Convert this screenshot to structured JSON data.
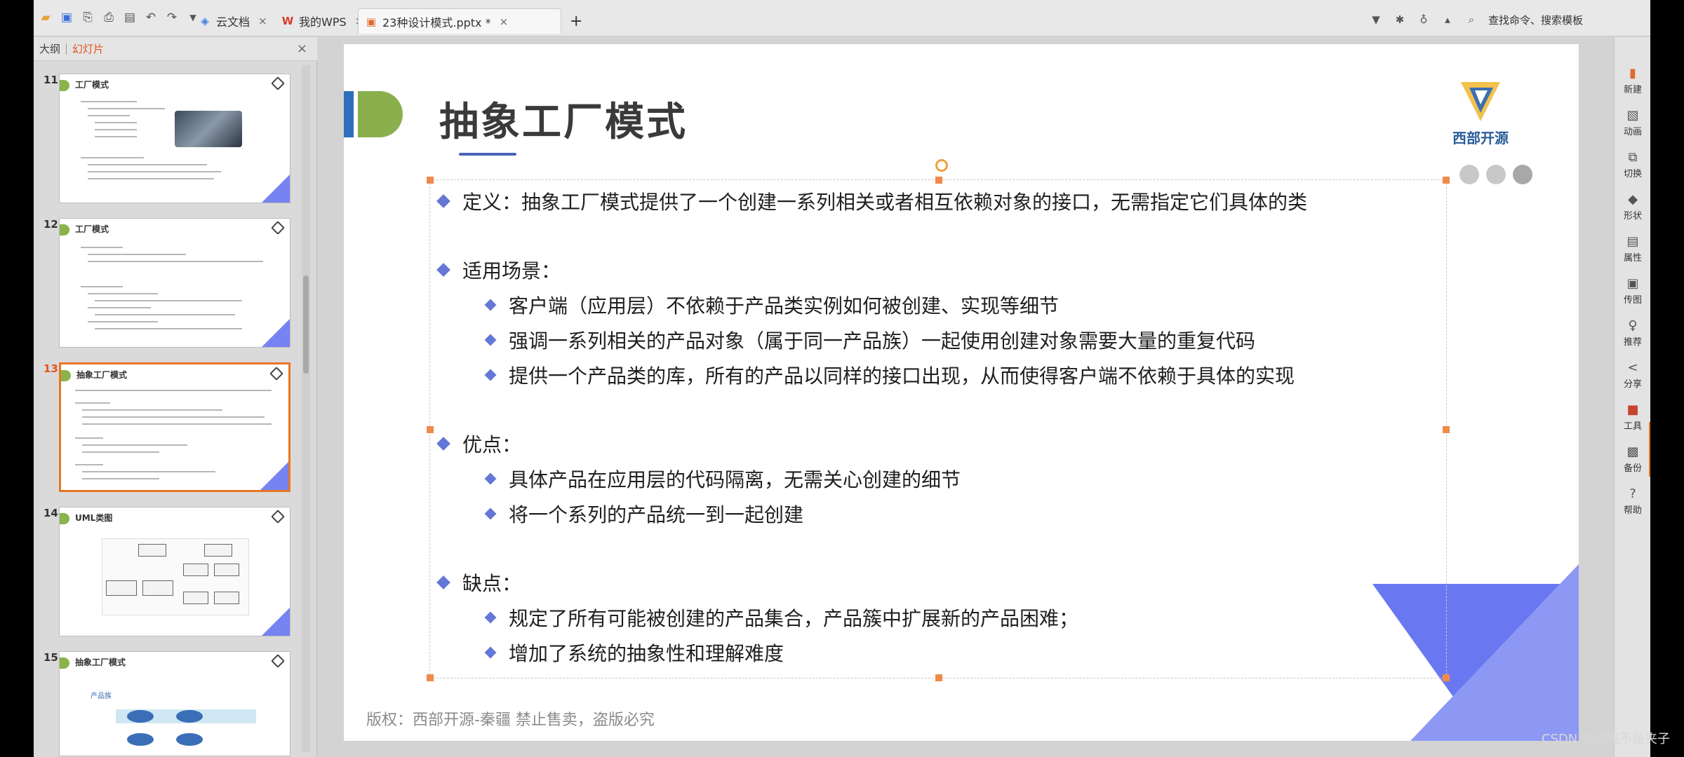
{
  "titlebar": {
    "quick_access": [
      "folder-icon",
      "save-icon",
      "export-icon",
      "print-icon",
      "preview-icon",
      "undo-icon",
      "redo-icon",
      "dropdown-icon"
    ],
    "tabs": [
      {
        "label": "云文档",
        "icon": "cloud-doc-icon"
      },
      {
        "label": "我的WPS",
        "icon": "wps-logo-icon"
      },
      {
        "label": "23种设计模式.pptx *",
        "icon": "pptx-icon"
      }
    ],
    "new_tab": "+",
    "search_label": "查找命令、搜索模板"
  },
  "left_panel": {
    "tabs": [
      "大纲",
      "幻灯片"
    ],
    "close": "×",
    "thumbnails": [
      {
        "num": "11",
        "title": "工厂模式"
      },
      {
        "num": "12",
        "title": "工厂模式"
      },
      {
        "num": "13",
        "title": "抽象工厂模式"
      },
      {
        "num": "14",
        "title": "UML类图"
      },
      {
        "num": "15",
        "title": "抽象工厂模式"
      }
    ],
    "thumb15_label": "产品族"
  },
  "slide": {
    "title": "抽象工厂模式",
    "logo_text": "西部开源",
    "definition": "定义：抽象工厂模式提供了一个创建一系列相关或者相互依赖对象的接口，无需指定它们具体的类",
    "scenarios_heading": "适用场景：",
    "scenarios": [
      "客户端（应用层）不依赖于产品类实例如何被创建、实现等细节",
      "强调一系列相关的产品对象（属于同一产品族）一起使用创建对象需要大量的重复代码",
      "提供一个产品类的库，所有的产品以同样的接口出现，从而使得客户端不依赖于具体的实现"
    ],
    "pros_heading": "优点：",
    "pros": [
      "具体产品在应用层的代码隔离，无需关心创建的细节",
      "将一个系列的产品统一到一起创建"
    ],
    "cons_heading": "缺点：",
    "cons": [
      "规定了所有可能被创建的产品集合，产品簇中扩展新的产品困难；",
      "增加了系统的抽象性和理解难度"
    ],
    "copyright": "版权：西部开源-秦疆    禁止售卖，盗版必究"
  },
  "right_toolbar": [
    {
      "label": "新建",
      "icon": "new-file-icon"
    },
    {
      "label": "动画",
      "icon": "animation-icon"
    },
    {
      "label": "切换",
      "icon": "transition-icon"
    },
    {
      "label": "形状",
      "icon": "shape-icon"
    },
    {
      "label": "属性",
      "icon": "property-icon"
    },
    {
      "label": "传图",
      "icon": "upload-image-icon"
    },
    {
      "label": "推荐",
      "icon": "recommend-icon"
    },
    {
      "label": "分享",
      "icon": "share-icon"
    },
    {
      "label": "工具",
      "icon": "toolbox-icon"
    },
    {
      "label": "备份",
      "icon": "backup-icon"
    },
    {
      "label": "帮助",
      "icon": "help-icon"
    }
  ],
  "watermark": "CSDN @胡桃不是夹子",
  "colors": {
    "accent": "#e87722",
    "slide_blue": "#2d6fbb",
    "slide_green": "#8ab04e",
    "bullet": "#6577d6",
    "triangle": "#5c6cf0"
  }
}
